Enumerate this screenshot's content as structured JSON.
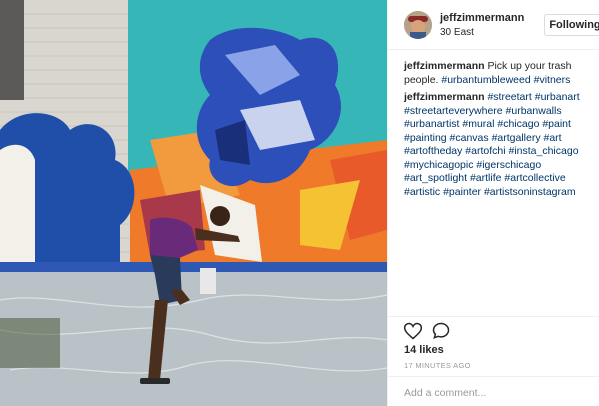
{
  "post": {
    "username": "jeffzimmermann",
    "location": "30 East",
    "follow_label": "Following"
  },
  "comments": [
    {
      "user": "jeffzimmermann",
      "text": "Pick up your trash people.",
      "tags": "#urbantumbleweed #vitners"
    },
    {
      "user": "jeffzimmermann",
      "text": "",
      "tags": "#streetart #urbanart #streetarteverywhere #urbanwalls #urbanartist #mural #chicago #paint #painting #canvas #artgallery #art #artoftheday #artofchi #insta_chicago #mychicagopic #igerschicago #art_spotlight #artlife #artcollective #artistic #painter #artistsoninstagram"
    }
  ],
  "actions": {
    "like_icon": "heart-outline-icon",
    "comment_icon": "speech-bubble-icon"
  },
  "likes": "14 likes",
  "timestamp": "17 MINUTES AGO",
  "add_comment": {
    "placeholder": "Add a comment..."
  },
  "colors": {
    "link": "#003569",
    "muted": "#999999",
    "border": "#efefef",
    "mural_teal": "#37b6b8",
    "mural_blue": "#1f4fa8",
    "mural_orange": "#ef7a2a"
  }
}
